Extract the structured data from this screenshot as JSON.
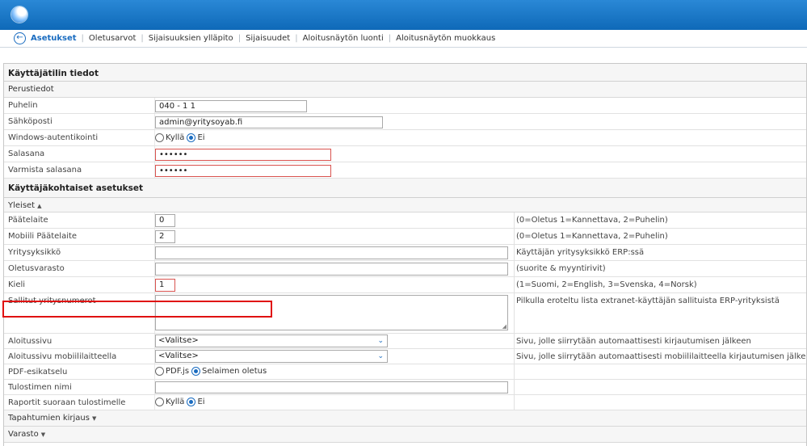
{
  "nav": {
    "back_icon": "arrow-left-icon",
    "items": [
      "Asetukset",
      "Oletusarvot",
      "Sijaisuuksien ylläpito",
      "Sijaisuudet",
      "Aloitusnäytön luonti",
      "Aloitusnäytön muokkaus"
    ]
  },
  "account": {
    "title": "Käyttäjätilin tiedot",
    "basic_title": "Perustiedot",
    "phone_label": "Puhelin",
    "phone_value": "040 - 1 1",
    "email_label": "Sähköposti",
    "email_value": "admin@yritysoyab.fi",
    "windows_auth_label": "Windows-autentikointi",
    "windows_auth_options": [
      "Kyllä",
      "Ei"
    ],
    "windows_auth_selected": "Ei",
    "password_label": "Salasana",
    "password_value": "••••••",
    "confirm_label": "Varmista salasana",
    "confirm_value": "••••••"
  },
  "user_settings": {
    "title": "Käyttäjäkohtaiset asetukset",
    "general_title": "Yleiset",
    "terminal_label": "Päätelaite",
    "terminal_value": "0",
    "terminal_hint": "(0=Oletus 1=Kannettava, 2=Puhelin)",
    "mobile_terminal_label": "Mobiili Päätelaite",
    "mobile_terminal_value": "2",
    "mobile_terminal_hint": "(0=Oletus 1=Kannettava, 2=Puhelin)",
    "unit_label": "Yritysyksikkö",
    "unit_value": "",
    "unit_hint": "Käyttäjän yritysyksikkö ERP:ssä",
    "warehouse_label": "Oletusvarasto",
    "warehouse_value": "",
    "warehouse_hint": "(suorite & myyntirivit)",
    "language_label": "Kieli",
    "language_value": "1",
    "language_hint": "(1=Suomi, 2=English, 3=Svenska, 4=Norsk)",
    "companies_label": "Sallitut yritysnumerot",
    "companies_hint": "Pilkulla eroteltu lista extranet-käyttäjän sallituista ERP-yrityksistä",
    "startpage_label": "Aloitussivu",
    "startpage_value": "<Valitse>",
    "startpage_hint": "Sivu, jolle siirrytään automaattisesti kirjautumisen jälkeen",
    "mobile_startpage_label": "Aloitussivu mobiililaitteella",
    "mobile_startpage_value": "<Valitse>",
    "mobile_startpage_hint": "Sivu, jolle siirrytään automaattisesti mobiililaitteella kirjautumisen jälkeen",
    "pdf_label": "PDF-esikatselu",
    "pdf_options": [
      "PDF.js",
      "Selaimen oletus"
    ],
    "pdf_selected": "Selaimen oletus",
    "printer_label": "Tulostimen nimi",
    "printer_value": "",
    "direct_print_label": "Raportit suoraan tulostimelle",
    "direct_print_options": [
      "Kyllä",
      "Ei"
    ],
    "direct_print_selected": "Ei"
  },
  "collapsed_sections": [
    "Tapahtumien kirjaus",
    "Varasto"
  ],
  "colors": {
    "header": "#1a6cc0",
    "highlight": "#e01010",
    "error": "#d9534f"
  }
}
